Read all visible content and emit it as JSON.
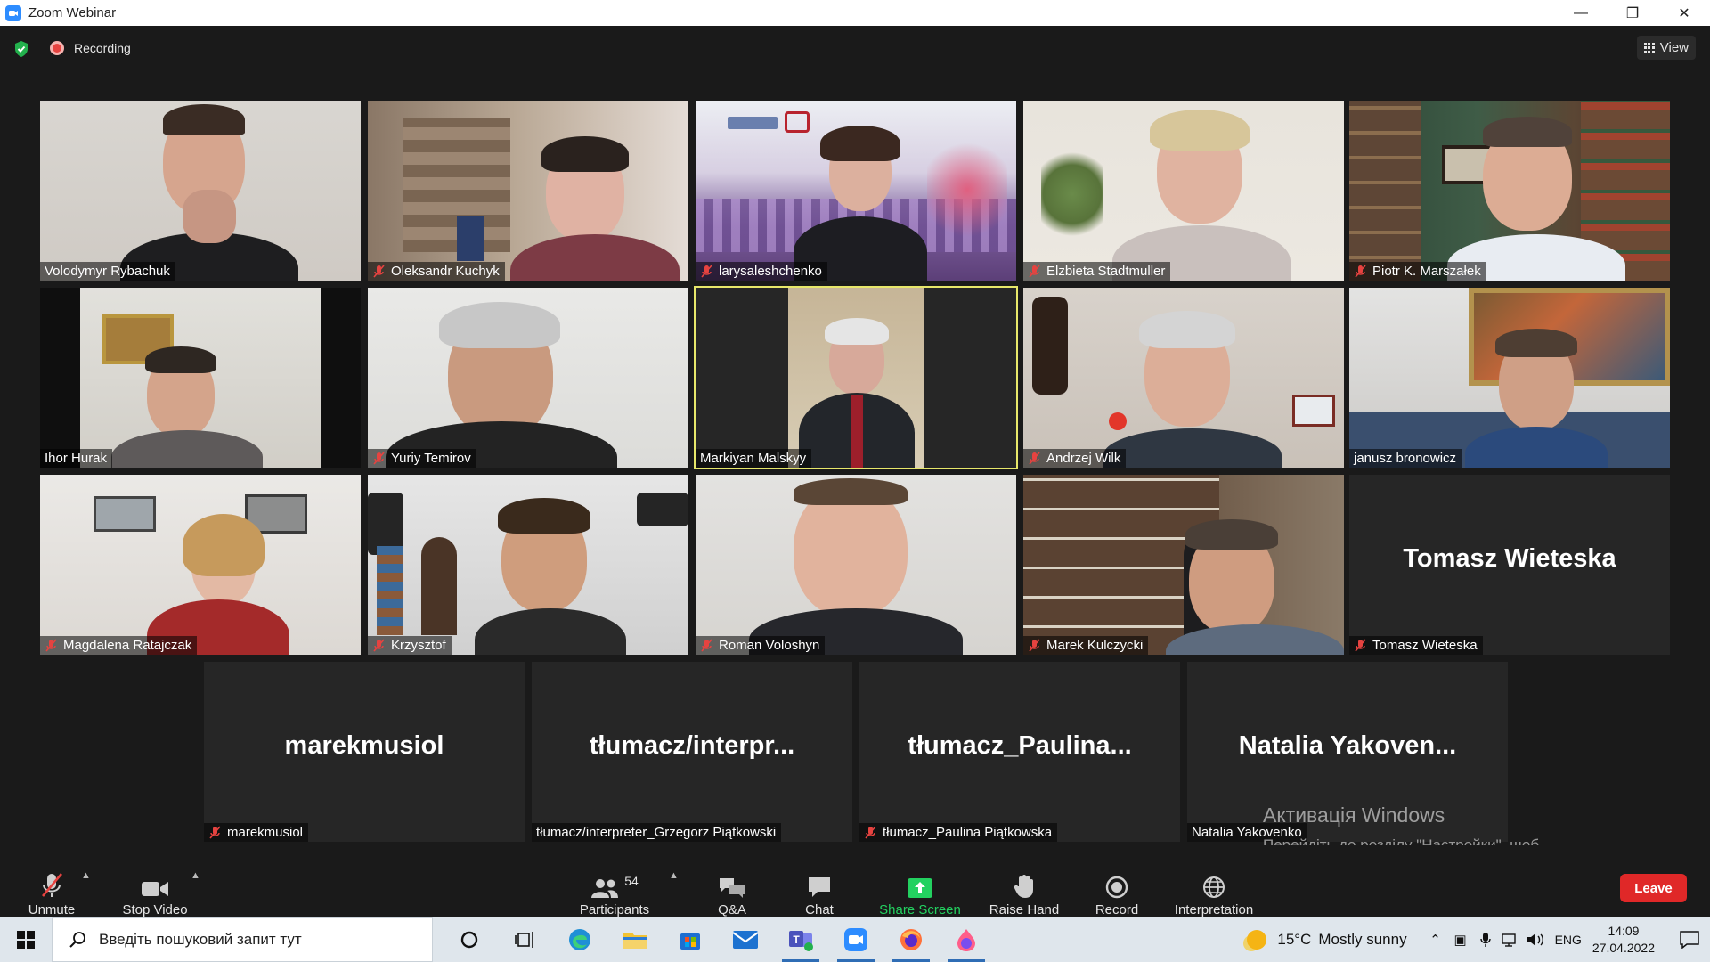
{
  "window": {
    "title": "Zoom Webinar",
    "minimize": "—",
    "restore": "❐",
    "close": "✕"
  },
  "topbar": {
    "recording_label": "Recording",
    "view_label": "View"
  },
  "tiles": [
    {
      "name": "Volodymyr Rybachuk",
      "muted": false
    },
    {
      "name": "Oleksandr Kuchyk",
      "muted": true
    },
    {
      "name": "larysaleshchenko",
      "muted": true
    },
    {
      "name": "Elzbieta Stadtmuller",
      "muted": true
    },
    {
      "name": "Piotr K. Marszałek",
      "muted": true
    },
    {
      "name": "Ihor Hurak",
      "muted": false
    },
    {
      "name": "Yuriy Temirov",
      "muted": true
    },
    {
      "name": "Markiyan Malskyy",
      "muted": false,
      "active_speaker": true
    },
    {
      "name": "Andrzej Wilk",
      "muted": true
    },
    {
      "name": "janusz bronowicz",
      "muted": false
    },
    {
      "name": "Magdalena Ratajczak",
      "muted": true
    },
    {
      "name": "Krzysztof",
      "muted": true
    },
    {
      "name": "Roman Voloshyn",
      "muted": true
    },
    {
      "name": "Marek Kulczycki",
      "muted": true
    },
    {
      "name": "Tomasz Wieteska",
      "muted": true,
      "display_name": "Tomasz Wieteska"
    },
    {
      "name": "marekmusiol",
      "muted": true,
      "display_name": "marekmusiol"
    },
    {
      "name": "tłumacz/interpreter_Grzegorz Piątkowski",
      "muted": false,
      "display_name": "tłumacz/interpr..."
    },
    {
      "name": "tłumacz_Paulina Piątkowska",
      "muted": true,
      "display_name": "tłumacz_Paulina..."
    },
    {
      "name": "Natalia Yakovenko",
      "muted": false,
      "display_name": "Natalia  Yakoven..."
    }
  ],
  "watermark": {
    "title": "Активація Windows",
    "subtitle": "Перейдіть до розділу \"Настройки\", щоб активувати Windows."
  },
  "toolbar": {
    "unmute": "Unmute",
    "stop_video": "Stop Video",
    "participants": "Participants",
    "participants_count": "54",
    "qa": "Q&A",
    "chat": "Chat",
    "share_screen": "Share Screen",
    "raise_hand": "Raise Hand",
    "record": "Record",
    "interpretation": "Interpretation",
    "leave": "Leave"
  },
  "taskbar": {
    "search_placeholder": "Введіть пошуковий запит тут",
    "weather_temp": "15°C",
    "weather_desc": "Mostly sunny",
    "language": "ENG",
    "time": "14:09",
    "date": "27.04.2022"
  },
  "colors": {
    "accent_green": "#23d160",
    "leave_red": "#e02828",
    "active_speaker": "#e7e76a",
    "muted_red": "#e64340"
  }
}
